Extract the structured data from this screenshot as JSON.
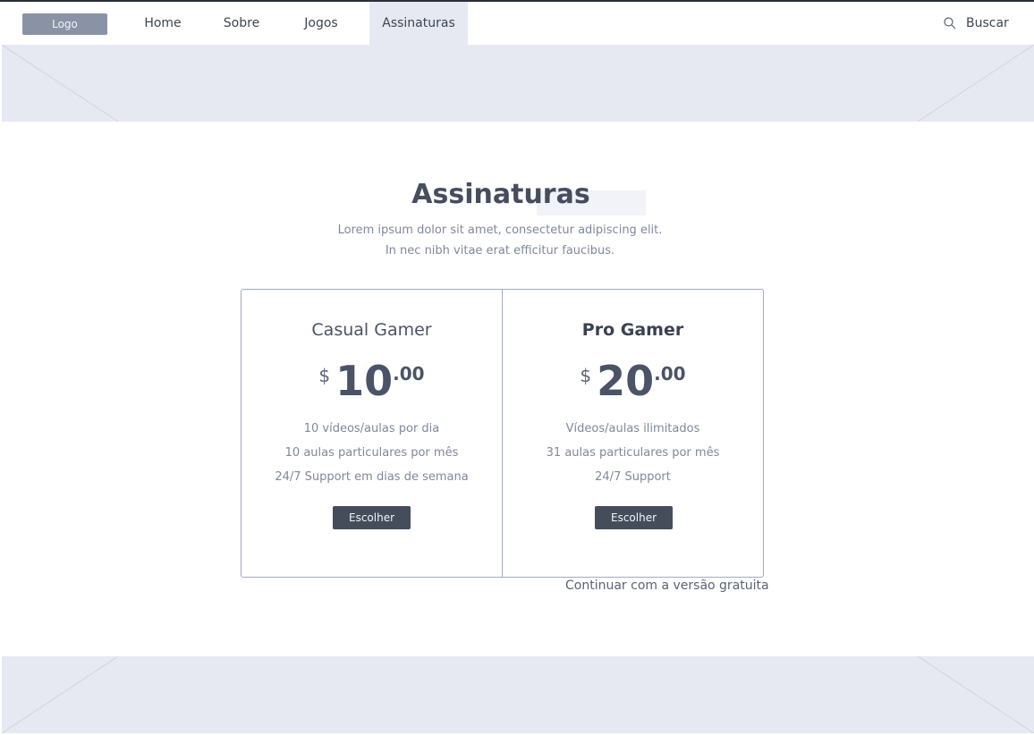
{
  "nav": {
    "logo": "Logo",
    "items": [
      "Home",
      "Sobre",
      "Jogos",
      "Assinaturas"
    ],
    "active": "Assinaturas",
    "search_label": "Buscar"
  },
  "page": {
    "title": "Assinaturas",
    "subtitle_line1": "Lorem ipsum dolor sit amet, consectetur adipiscing elit.",
    "subtitle_line2": "In nec nibh vitae erat efficitur faucibus."
  },
  "plans": [
    {
      "name": "Casual Gamer",
      "currency": "$",
      "amount": "10",
      "cents": ".00",
      "features": [
        "10 vídeos/aulas por dia",
        "10 aulas particulares por mês",
        "24/7 Support em dias de semana"
      ],
      "button": "Escolher"
    },
    {
      "name": "Pro Gamer",
      "currency": "$",
      "amount": "20",
      "cents": ".00",
      "features": [
        "Vídeos/aulas ilimitados",
        "31 aulas particulares por mês",
        "24/7 Support"
      ],
      "button": "Escolher"
    }
  ],
  "free_link": "Continuar com a versão gratuita",
  "colors": {
    "placeholder_bg": "#e6e9f1",
    "button_bg": "#454d5b",
    "logo_bg": "#8a93a6"
  }
}
